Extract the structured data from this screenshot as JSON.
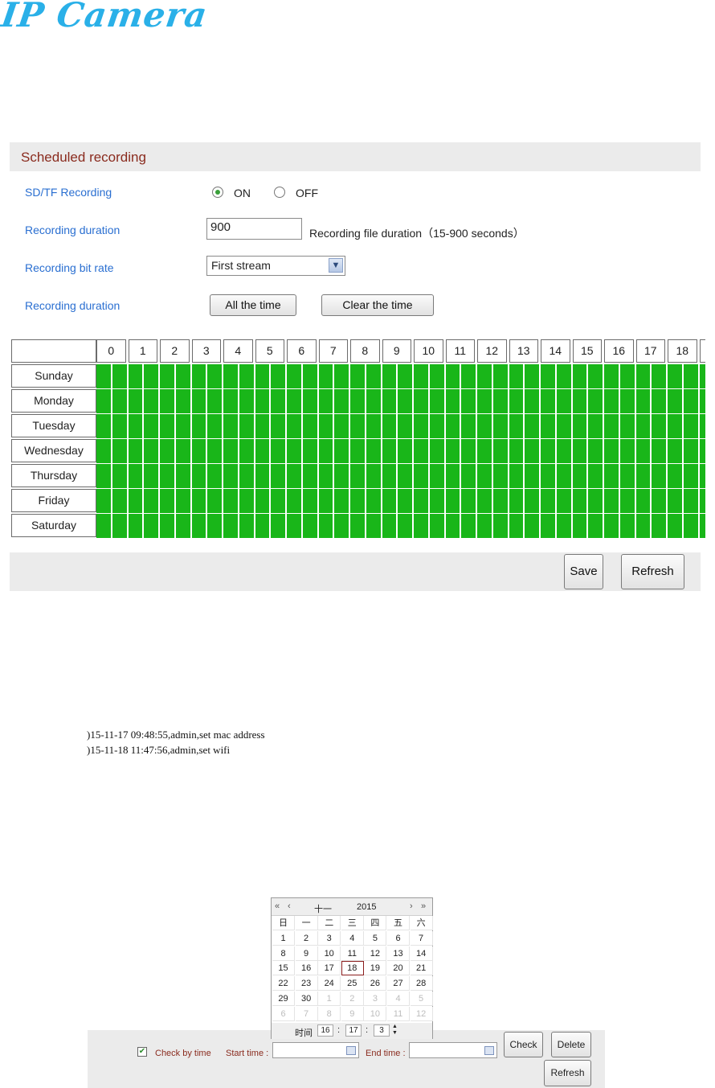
{
  "logo": {
    "text": "IP Camera",
    "color": "#2ab0e8"
  },
  "section": {
    "title": "Scheduled recording"
  },
  "form": {
    "sdtf_label": "SD/TF Recording",
    "radio_on": "ON",
    "radio_off": "OFF",
    "sdtf_selected": "ON",
    "duration_label": "Recording duration",
    "duration_value": "900",
    "duration_hint": "Recording file duration（15-900 seconds）",
    "bitrate_label": "Recording bit rate",
    "bitrate_value": "First stream",
    "schedule_label": "Recording duration",
    "all_time_button": "All the time",
    "clear_time_button": "Clear the time"
  },
  "schedule": {
    "hours": [
      "0",
      "1",
      "2",
      "3",
      "4",
      "5",
      "6",
      "7",
      "8",
      "9",
      "10",
      "11",
      "12",
      "13",
      "14",
      "15",
      "16",
      "17",
      "18"
    ],
    "days": [
      "Sunday",
      "Monday",
      "Tuesday",
      "Wednesday",
      "Thursday",
      "Friday",
      "Saturday"
    ],
    "active_color": "#19b619",
    "all_slots_active": true
  },
  "footer": {
    "save_button": "Save",
    "refresh_button": "Refresh"
  },
  "log": {
    "lines": [
      ")15-11-17 09:48:55,admin,set mac address",
      ")15-11-18 11:47:56,admin,set wifi"
    ]
  },
  "calendar": {
    "nav_prev_year": "«",
    "nav_prev_month": "‹",
    "nav_next_month": "›",
    "nav_next_year": "»",
    "month": "十一",
    "year": "2015",
    "weekdays": [
      "日",
      "一",
      "二",
      "三",
      "四",
      "五",
      "六"
    ],
    "weeks": [
      [
        "1",
        "2",
        "3",
        "4",
        "5",
        "6",
        "7"
      ],
      [
        "8",
        "9",
        "10",
        "11",
        "12",
        "13",
        "14"
      ],
      [
        "15",
        "16",
        "17",
        "18",
        "19",
        "20",
        "21"
      ],
      [
        "22",
        "23",
        "24",
        "25",
        "26",
        "27",
        "28"
      ],
      [
        "29",
        "30",
        "1",
        "2",
        "3",
        "4",
        "5"
      ],
      [
        "6",
        "7",
        "8",
        "9",
        "10",
        "11",
        "12"
      ]
    ],
    "today": "18",
    "time_label": "时间",
    "hour": "16",
    "minute": "17",
    "second": "3"
  },
  "filter": {
    "check_by_time": "Check by time",
    "checked": true,
    "start_label": "Start time :",
    "start_value": "",
    "end_label": "End time :",
    "end_value": "",
    "check_button": "Check",
    "delete_button": "Delete",
    "refresh_button": "Refresh"
  }
}
